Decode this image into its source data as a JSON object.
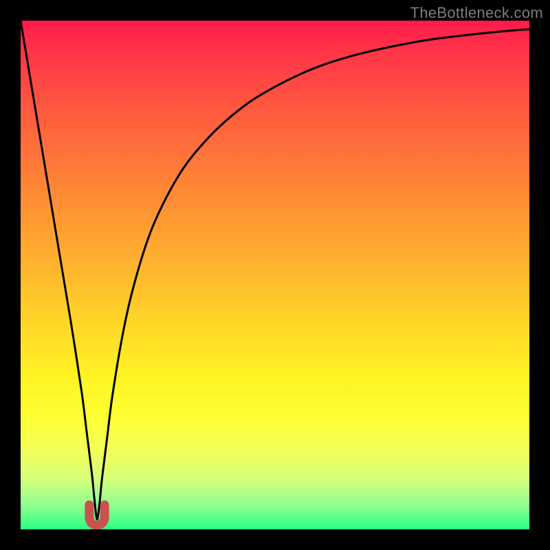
{
  "watermark": "TheBottleneck.com",
  "chart_data": {
    "type": "line",
    "title": "",
    "xlabel": "",
    "ylabel": "",
    "xlim": [
      0,
      100
    ],
    "ylim": [
      0,
      100
    ],
    "gradient_axis": "y",
    "gradient_stops": [
      {
        "pos": 0,
        "color": "#ff1a4b",
        "meaning": "high"
      },
      {
        "pos": 50,
        "color": "#ffc229",
        "meaning": "mid"
      },
      {
        "pos": 78,
        "color": "#fdff33",
        "meaning": "low-mid"
      },
      {
        "pos": 100,
        "color": "#2bff85",
        "meaning": "low"
      }
    ],
    "minimum": {
      "x": 15,
      "y": 2
    },
    "series": [
      {
        "name": "bottleneck-curve",
        "x": [
          0,
          2,
          4,
          6,
          8,
          10,
          12,
          13,
          14,
          14.5,
          15,
          15.5,
          16,
          17,
          18,
          20,
          22,
          25,
          28,
          32,
          36,
          40,
          45,
          50,
          55,
          60,
          66,
          72,
          80,
          88,
          96,
          100
        ],
        "values": [
          100,
          88,
          76,
          64,
          52,
          40,
          27,
          19,
          11,
          6,
          2,
          5,
          10,
          18,
          26,
          38,
          47,
          57,
          64,
          71,
          76,
          80,
          84,
          87,
          89.5,
          91.5,
          93.3,
          94.7,
          96.2,
          97.2,
          98,
          98.3
        ]
      }
    ],
    "minimum_marker": {
      "shape": "u",
      "color": "#c9524f",
      "x_center": 15,
      "width_pct": 3,
      "height_pct": 4
    }
  }
}
